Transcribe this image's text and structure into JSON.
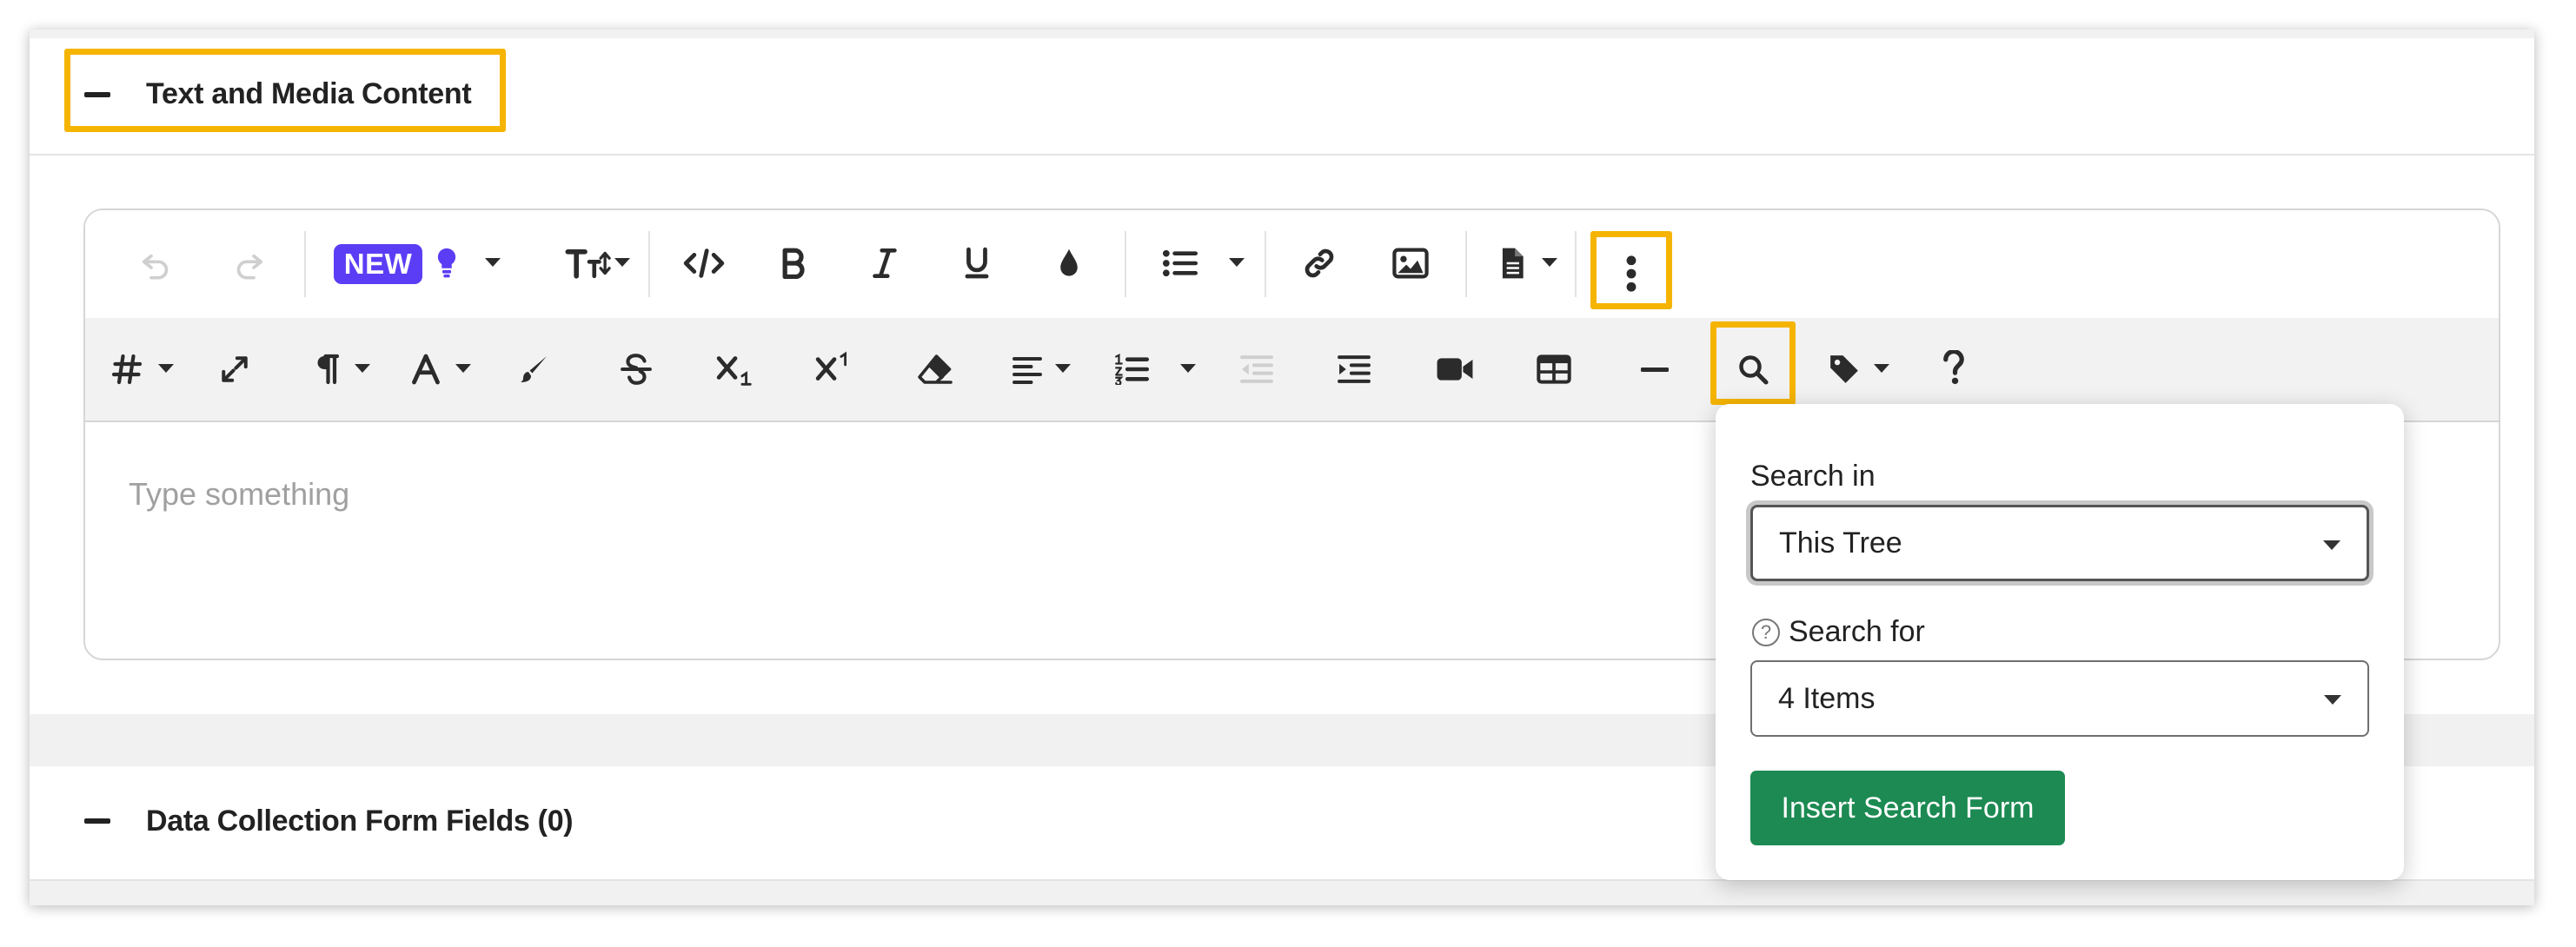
{
  "sections": {
    "text_media": {
      "title": "Text and Media Content"
    },
    "data_collection": {
      "title": "Data Collection Form Fields (0)"
    }
  },
  "toolbar": {
    "new_badge": "NEW",
    "row1_icons": [
      "undo-icon",
      "redo-icon",
      "lightbulb-icon",
      "text-size-icon",
      "code-icon",
      "bold-icon",
      "italic-icon",
      "underline-icon",
      "text-color-icon",
      "bulleted-list-icon",
      "link-icon",
      "image-icon",
      "file-icon",
      "more-options-icon"
    ],
    "row2_icons": [
      "heading-icon",
      "fullscreen-icon",
      "paragraph-format-icon",
      "font-icon",
      "paint-brush-icon",
      "strikethrough-icon",
      "subscript-icon",
      "superscript-icon",
      "clear-formatting-icon",
      "align-icon",
      "numbered-list-icon",
      "outdent-icon",
      "indent-icon",
      "video-icon",
      "table-icon",
      "horizontal-line-icon",
      "search-icon",
      "tag-icon",
      "help-icon"
    ]
  },
  "editor": {
    "placeholder": "Type something"
  },
  "search_popover": {
    "search_in_label": "Search in",
    "search_in_value": "This Tree",
    "search_for_label": "Search for",
    "search_for_value": "4 Items",
    "help_glyph": "?",
    "insert_button": "Insert Search Form"
  },
  "colors": {
    "highlight": "#f5b400",
    "new_badge": "#5b3df5",
    "insert_button": "#1c8a52",
    "placeholder": "#a0a0a0"
  }
}
